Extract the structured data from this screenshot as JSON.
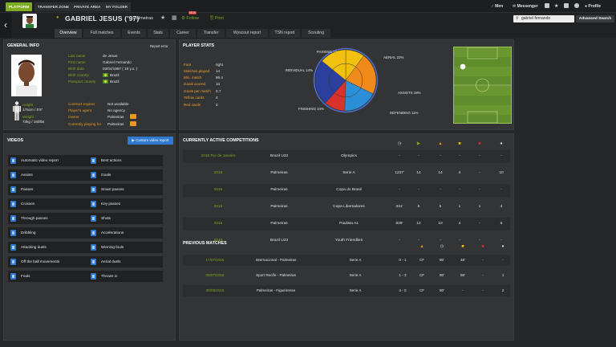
{
  "nav": {
    "tabs": [
      "PLATFORM",
      "TRANSFER ZONE",
      "PRIVATE AREA",
      "MY FOLDER"
    ],
    "right": {
      "men": "Men",
      "messenger": "Messenger",
      "profile": "Profile"
    }
  },
  "player": {
    "name": "GABRIEL JESUS ('97)",
    "club": "Palmeiras",
    "follow": "Follow",
    "follow_badge": "NEW",
    "print": "Print"
  },
  "search": {
    "value": "gabriel fernando",
    "advanced": "Advanced Search"
  },
  "subtabs": [
    "Overview",
    "Full matches",
    "Events",
    "Stats",
    "Career",
    "Transfer",
    "Wyscout report",
    "TSN report",
    "Scouting"
  ],
  "general_info": {
    "title": "GENERAL INFO",
    "report_error": "Report error",
    "fields": [
      {
        "label": "Last name",
        "value": "de Jesus"
      },
      {
        "label": "First name",
        "value": "Gabriel Fernando"
      },
      {
        "label": "Birth date",
        "value": "03/04/1997 ( 19 y.o. )"
      },
      {
        "label": "Birth country",
        "value": "Brazil",
        "flag": true
      },
      {
        "label": "Passport country",
        "value": "Brazil",
        "flag": true
      }
    ],
    "height_label": "Height",
    "height_value": "175cm / 5'9\"",
    "weight_label": "Weight",
    "weight_value": "73kg / 160lbs",
    "contract": [
      {
        "label": "Contract expires",
        "value": "Not available"
      },
      {
        "label": "Player's agent",
        "value": "No agency"
      },
      {
        "label": "Owner",
        "value": "Palmeiras"
      },
      {
        "label": "Currently playing for",
        "value": "Palmeiras"
      }
    ]
  },
  "player_stats": {
    "title": "PLAYER STATS",
    "rows": [
      {
        "label": "Foot",
        "value": "right"
      },
      {
        "label": "Matches played",
        "value": "14"
      },
      {
        "label": "Min. match",
        "value": "86.4"
      },
      {
        "label": "Goals scored",
        "value": "10"
      },
      {
        "label": "Goals per match",
        "value": "0.7"
      },
      {
        "label": "Yellow cards",
        "value": "4"
      },
      {
        "label": "Red cards",
        "value": "0"
      }
    ]
  },
  "chart_data": {
    "type": "pie",
    "slices": [
      {
        "label": "PASSING 10%",
        "value": 10,
        "color": "#f2c00f"
      },
      {
        "label": "AERIAL 22%",
        "value": 22,
        "color": "#f08a1a"
      },
      {
        "label": "ASSISTS 18%",
        "value": 18,
        "color": "#2b8fd8"
      },
      {
        "label": "DEFENDING 11%",
        "value": 11,
        "color": "#d8322b"
      },
      {
        "label": "FINISHING 24%",
        "value": 24,
        "color": "#2a3f9e"
      },
      {
        "label": "INDIVIDUAL 14%",
        "value": 14,
        "color": "#f2c00f"
      }
    ]
  },
  "videos": {
    "title": "VIDEOS",
    "custom_button": "Custom video report",
    "left": [
      "Automatic video report",
      "Assists",
      "Passes",
      "Crosses",
      "Through passes",
      "Dribbling",
      "Attacking duels",
      "Off the ball movements",
      "Fouls"
    ],
    "right": [
      "Best actions",
      "Goals",
      "Smart passes",
      "Key passes",
      "Shots",
      "Accelerations",
      "Winning fouls",
      "Aerial duels",
      "Throws in"
    ]
  },
  "competitions": {
    "title": "CURRENTLY ACTIVE COMPETITIONS",
    "header_colors": [
      "#cfcfcf",
      "#7fad22",
      "#e89a1a",
      "#f2c00f",
      "#d8322b",
      "#dcdcdc"
    ],
    "rows": [
      [
        "2016 Rio de Janeiro",
        "Brazil U23",
        "Olympics",
        "-",
        "-",
        "-",
        "-",
        "-",
        "-"
      ],
      [
        "2016",
        "Palmeiras",
        "Serie A",
        "1237'",
        "14",
        "14",
        "4",
        "-",
        "10"
      ],
      [
        "2016",
        "Palmeiras",
        "Copa do Brasil",
        "-",
        "-",
        "-",
        "-",
        "-",
        "-"
      ],
      [
        "2016",
        "Palmeiras",
        "Copa Libertadores",
        "341'",
        "5",
        "5",
        "1",
        "1",
        "4"
      ],
      [
        "2016",
        "Palmeiras",
        "Paulista A1",
        "828'",
        "12",
        "10",
        "4",
        "-",
        "5"
      ],
      [
        "2016",
        "Brazil U23",
        "Youth Friendlies",
        "-",
        "-",
        "-",
        "-",
        "-",
        "-"
      ]
    ]
  },
  "previous": {
    "title": "PREVIOUS MATCHES",
    "header_colors": [
      "#e89a1a",
      "#cfcfcf",
      "#f2c00f",
      "#d8322b",
      "#dcdcdc"
    ],
    "rows": [
      [
        "17/07/2016",
        "Internacional - Palmeiras",
        "Serie A",
        "0 - 1",
        "CF",
        "90'",
        "48'",
        "-",
        "-"
      ],
      [
        "05/07/2016",
        "Sport Recife - Palmeiras",
        "Serie A",
        "1 - 3",
        "CF",
        "90'",
        "56'",
        "-",
        "1"
      ],
      [
        "30/06/2016",
        "Palmeiras - Figueirense",
        "Serie A",
        "4 - 0",
        "CF",
        "90'",
        "-",
        "-",
        "2"
      ]
    ]
  }
}
